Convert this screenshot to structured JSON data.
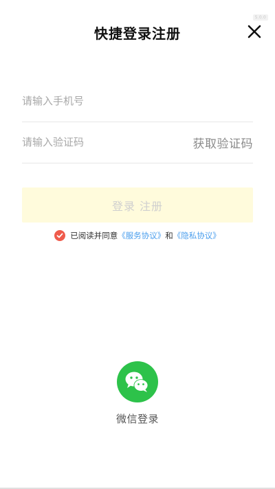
{
  "status_tag": "5.0.0",
  "header": {
    "title": "快捷登录注册"
  },
  "form": {
    "phone_placeholder": "请输入手机号",
    "code_placeholder": "请输入验证码",
    "get_code_label": "获取验证码",
    "submit_label": "登录 注册"
  },
  "agreement": {
    "prefix": "已阅读并同意",
    "service_link": "《服务协议》",
    "conjunction": "和",
    "privacy_link": "《隐私协议》",
    "checked": true
  },
  "social": {
    "wechat_label": "微信登录"
  },
  "colors": {
    "accent_check": "#ef5b4c",
    "link": "#4a9eed",
    "wechat": "#2dc24a",
    "button_bg": "#fffbdc"
  },
  "icons": [
    "close-icon",
    "check-icon",
    "wechat-icon"
  ]
}
